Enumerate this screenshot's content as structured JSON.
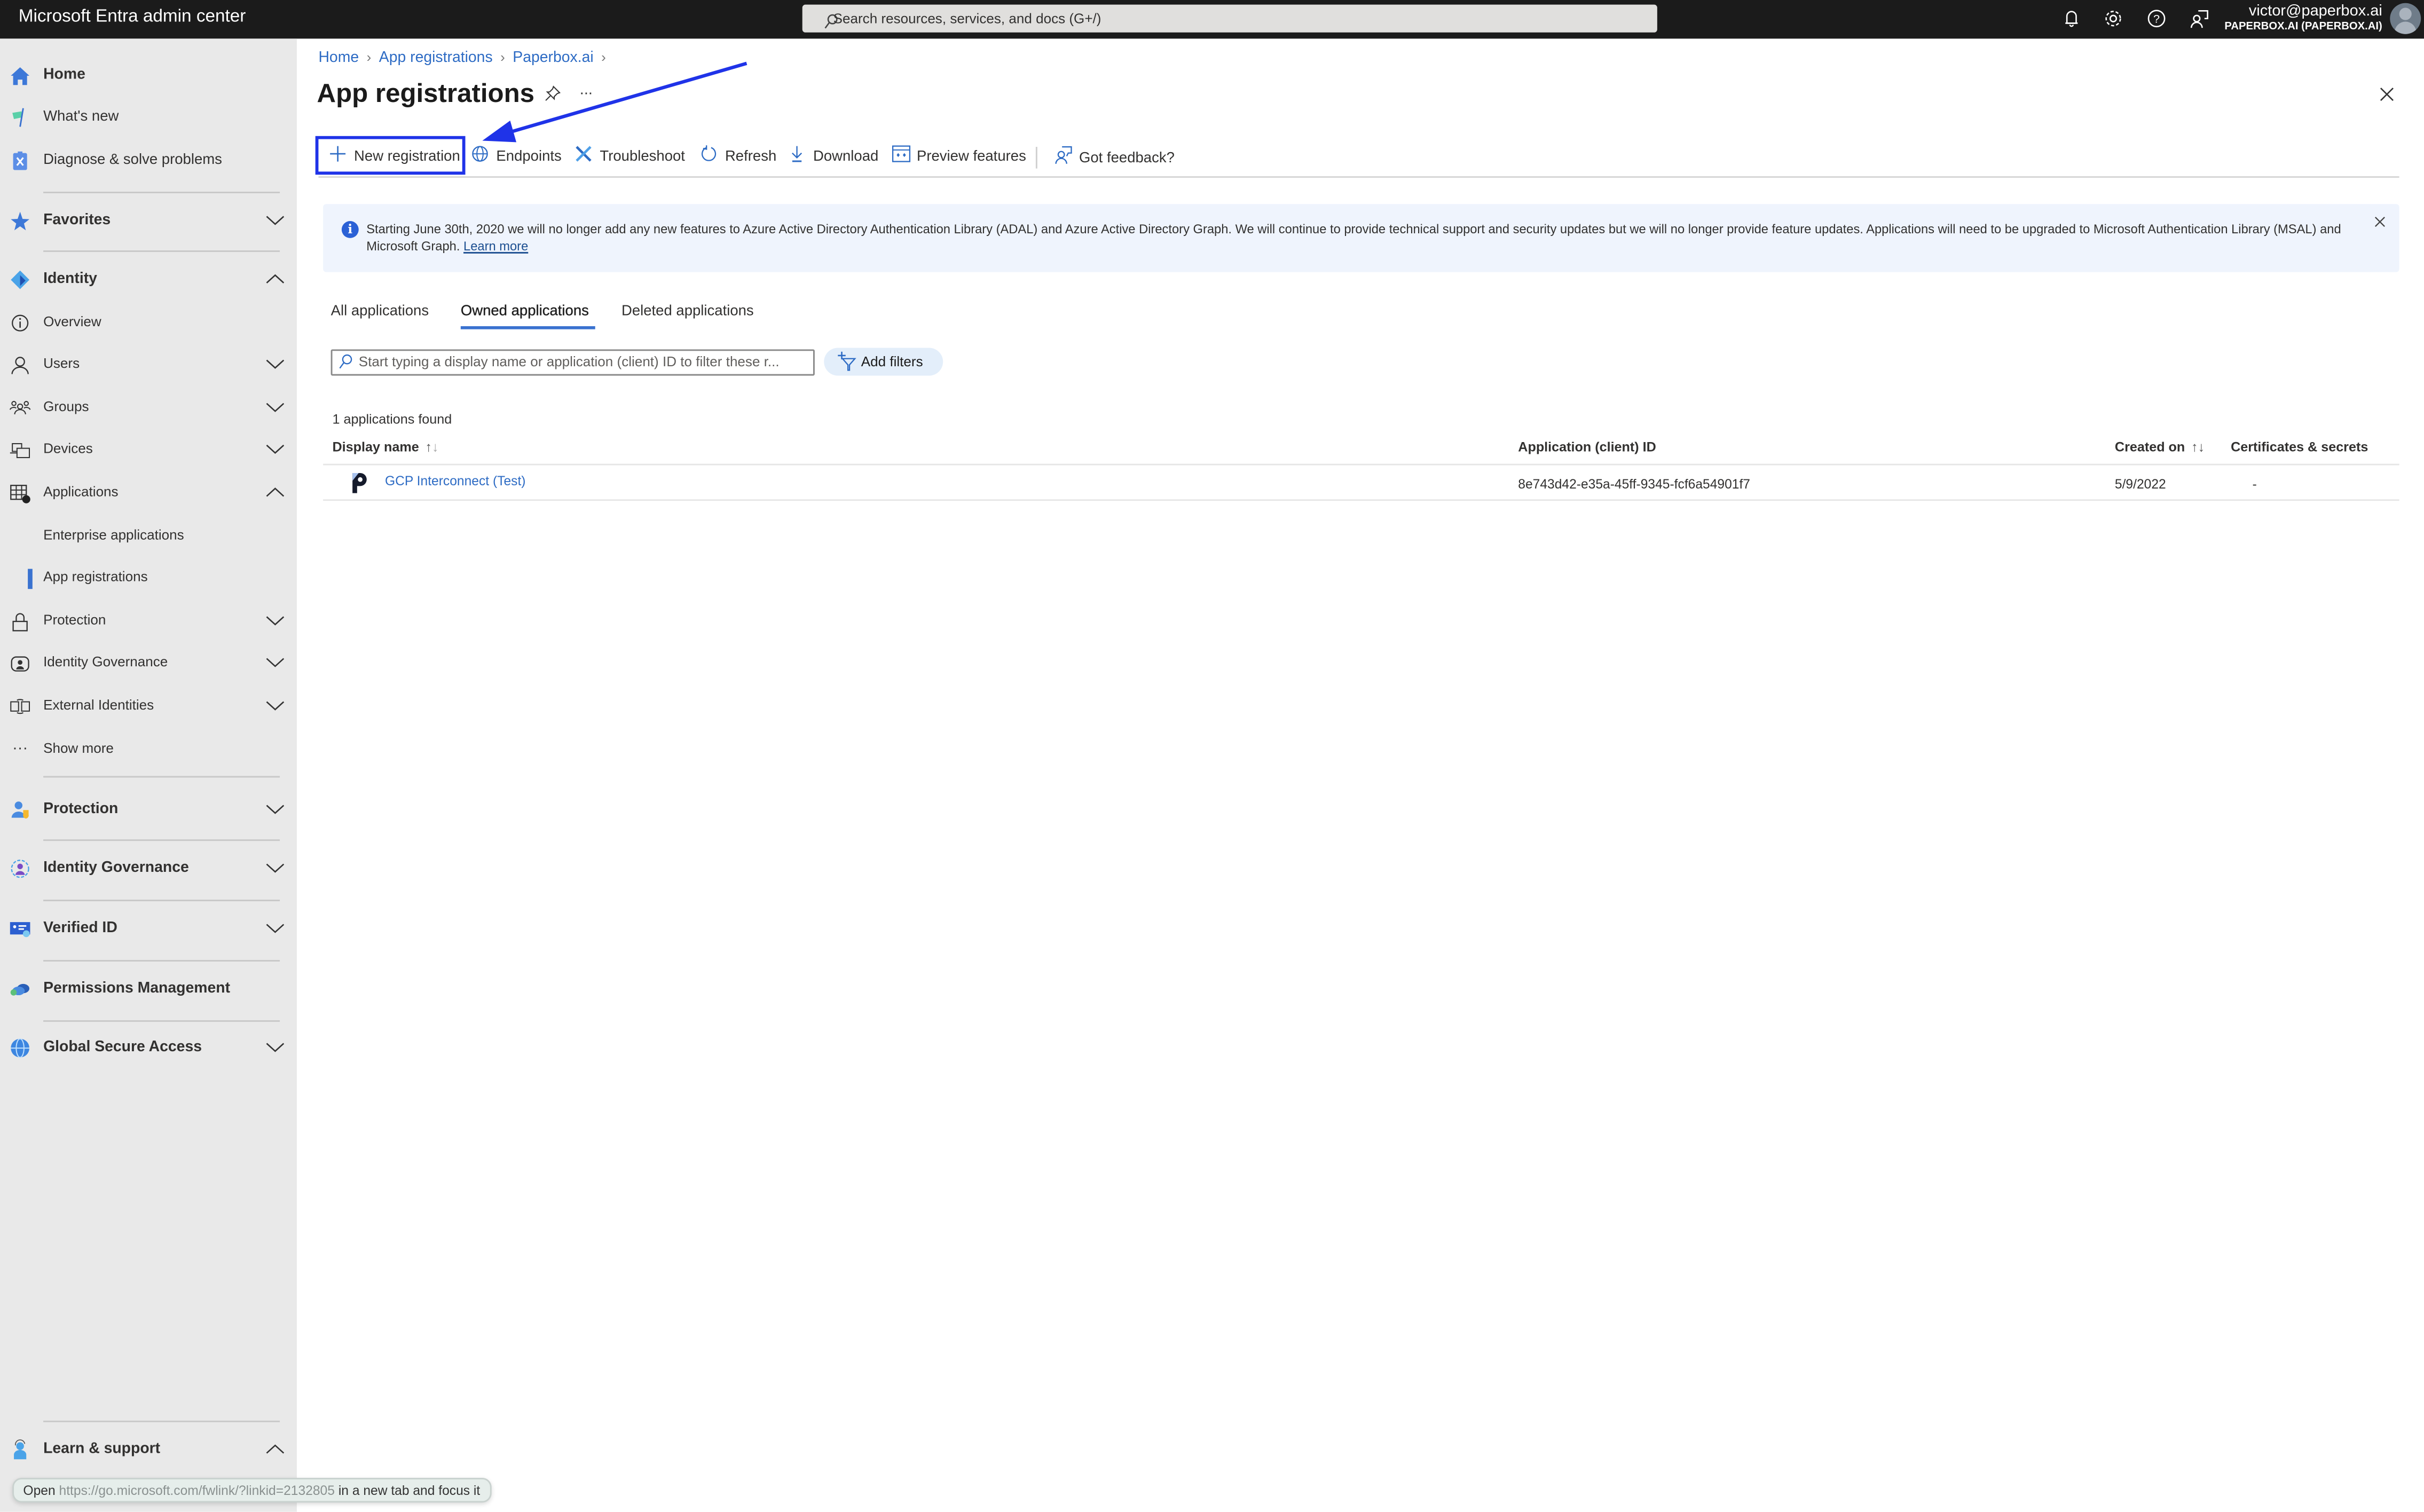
{
  "topbar": {
    "app_title": "Microsoft Entra admin center",
    "search_placeholder": "Search resources, services, and docs (G+/)",
    "icons": [
      "bell-icon",
      "gear-icon",
      "help-icon",
      "feedback-icon"
    ],
    "user_email": "victor@paperbox.ai",
    "user_tenant": "PAPERBOX.AI (PAPERBOX.AI)"
  },
  "sidebar": {
    "top_items": [
      {
        "label": "Home",
        "icon": "home-icon"
      },
      {
        "label": "What's new",
        "icon": "flag-icon"
      },
      {
        "label": "Diagnose & solve problems",
        "icon": "diagnose-icon"
      }
    ],
    "favorites": {
      "label": "Favorites",
      "icon": "star-icon"
    },
    "identity": {
      "label": "Identity",
      "icon": "identity-icon",
      "items": [
        {
          "label": "Overview",
          "icon": "info-icon"
        },
        {
          "label": "Users",
          "icon": "user-icon"
        },
        {
          "label": "Groups",
          "icon": "groups-icon"
        },
        {
          "label": "Devices",
          "icon": "devices-icon"
        },
        {
          "label": "Applications",
          "icon": "applications-icon"
        },
        {
          "label": "Enterprise applications"
        },
        {
          "label": "App registrations",
          "selected": true
        },
        {
          "label": "Protection",
          "icon": "lock-icon"
        },
        {
          "label": "Identity Governance",
          "icon": "governance-icon"
        },
        {
          "label": "External Identities",
          "icon": "external-identities-icon"
        },
        {
          "label": "Show more",
          "icon": "ellipsis-icon"
        }
      ]
    },
    "sections": [
      {
        "label": "Protection",
        "icon": "protection-icon"
      },
      {
        "label": "Identity Governance",
        "icon": "identity-governance-icon"
      },
      {
        "label": "Verified ID",
        "icon": "verified-id-icon"
      },
      {
        "label": "Permissions Management",
        "icon": "permissions-cloud-icon"
      },
      {
        "label": "Global Secure Access",
        "icon": "globe-icon"
      }
    ],
    "learn": {
      "label": "Learn & support",
      "icon": "support-icon"
    }
  },
  "breadcrumb": [
    "Home",
    "App registrations",
    "Paperbox.ai"
  ],
  "page": {
    "title": "App registrations",
    "more_label": "..."
  },
  "toolbar": {
    "new_registration": "New registration",
    "endpoints": "Endpoints",
    "troubleshoot": "Troubleshoot",
    "refresh": "Refresh",
    "download": "Download",
    "preview_features": "Preview features",
    "feedback": "Got feedback?"
  },
  "banner": {
    "text": "Starting June 30th, 2020 we will no longer add any new features to Azure Active Directory Authentication Library (ADAL) and Azure Active Directory Graph. We will continue to provide technical support and security updates but we will no longer provide feature updates. Applications will need to be upgraded to Microsoft Authentication Library (MSAL) and Microsoft Graph. ",
    "link": "Learn more"
  },
  "tabs": [
    {
      "label": "All applications",
      "active": false
    },
    {
      "label": "Owned applications",
      "active": true
    },
    {
      "label": "Deleted applications",
      "active": false
    }
  ],
  "filter": {
    "placeholder": "Start typing a display name or application (client) ID to filter these r...",
    "value": "",
    "add_filters": "Add filters"
  },
  "table": {
    "count_text": "1 applications found",
    "columns": [
      "Display name",
      "Application (client) ID",
      "Created on",
      "Certificates & secrets"
    ],
    "rows": [
      {
        "display_name": "GCP Interconnect (Test)",
        "client_id": "8e743d42-e35a-45ff-9345-fcf6a54901f7",
        "created_on": "5/9/2022",
        "certificates": "-"
      }
    ]
  },
  "status_tooltip": {
    "prefix": "Open",
    "url": "https://go.microsoft.com/fwlink/?linkid=2132805",
    "suffix": "in a new tab and focus it"
  },
  "annotation": {
    "color": "#1f33e8",
    "target": "New registration"
  }
}
